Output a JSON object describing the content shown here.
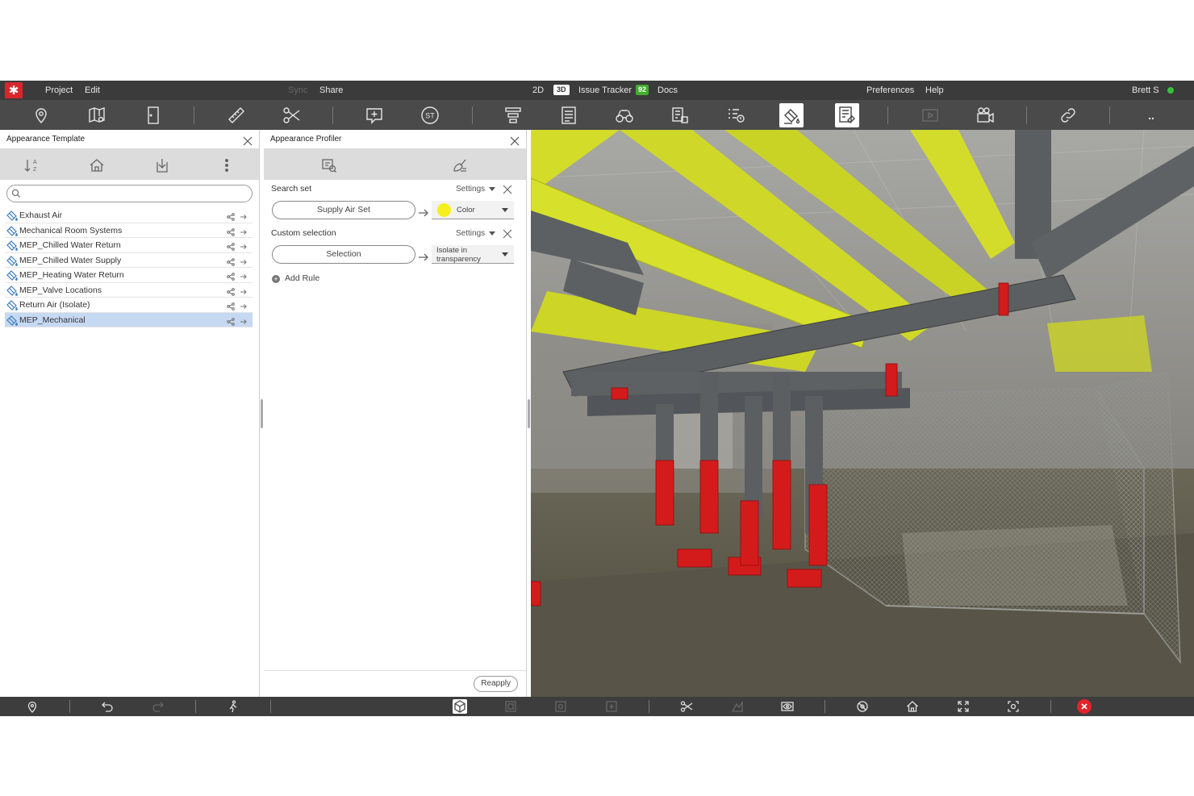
{
  "menubar": {
    "project": "Project",
    "edit": "Edit",
    "sync": "Sync",
    "share": "Share",
    "view_2d": "2D",
    "view_3d": "3D",
    "issue_tracker": "Issue Tracker",
    "issue_count": "92",
    "docs": "Docs",
    "preferences": "Preferences",
    "help": "Help",
    "user": "Brett S",
    "status_color": "#35c23a"
  },
  "toolbar": {
    "icons": [
      "location-pin-icon",
      "map-icon",
      "door-icon",
      "ruler-icon",
      "scissors-icon",
      "add-comment-icon",
      "st-icon",
      "layers-icon",
      "list-icon",
      "binoculars-icon",
      "model-tree-icon",
      "properties-icon",
      "appearance-template-icon",
      "appearance-profiler-icon",
      "video-icon",
      "camera-icon",
      "link-icon",
      "more-icon"
    ],
    "st_label": "ST",
    "more_label": ".."
  },
  "left_panel": {
    "title": "Appearance Template",
    "search_placeholder": "",
    "items": [
      {
        "label": "Exhaust Air",
        "selected": false
      },
      {
        "label": "Mechanical Room Systems",
        "selected": false
      },
      {
        "label": "MEP_Chilled Water Return",
        "selected": false
      },
      {
        "label": "MEP_Chilled Water Supply",
        "selected": false
      },
      {
        "label": "MEP_Heating Water Return",
        "selected": false
      },
      {
        "label": "MEP_Valve Locations",
        "selected": false
      },
      {
        "label": "Return Air (Isolate)",
        "selected": false
      },
      {
        "label": "MEP_Mechanical",
        "selected": true
      }
    ]
  },
  "middle_panel": {
    "title": "Appearance Profiler",
    "rules": [
      {
        "type_label": "Search set",
        "settings": "Settings",
        "source": "Supply Air Set",
        "action": "Color",
        "swatch": "#f6ef1d"
      },
      {
        "type_label": "Custom selection",
        "settings": "Settings",
        "source": "Selection",
        "action_line1": "Isolate in",
        "action_line2": "transparency"
      }
    ],
    "add_rule": "Add Rule",
    "reapply": "Reapply"
  },
  "colors": {
    "menubar_bg": "#3b3b3b",
    "toolbar_bg": "#4a4a4a",
    "accent_red": "#d9262c",
    "selection_blue": "#c6d9f3",
    "duct_yellow": "#d6e02a",
    "pipe_gray": "#5d6163",
    "valve_red": "#d41b1b"
  }
}
